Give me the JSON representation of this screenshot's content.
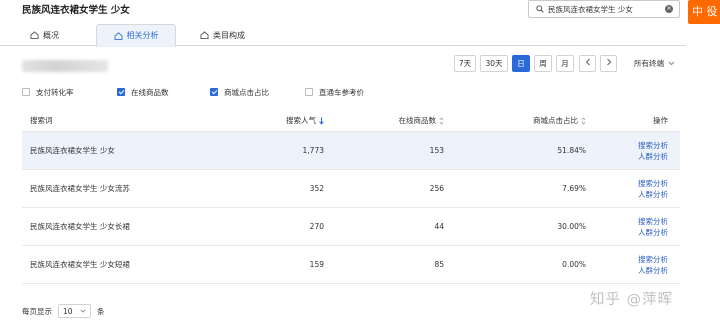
{
  "title": "民族风连衣裙女学生 少女",
  "search": {
    "value": "民族风连衣裙女学生 少女"
  },
  "side_tab": "中 役",
  "tabs": [
    {
      "label": "概况"
    },
    {
      "label": "相关分析"
    },
    {
      "label": "类目构成"
    }
  ],
  "date_buttons": [
    "7天",
    "30天",
    "日",
    "周",
    "月"
  ],
  "terminal": "所有终端",
  "checkboxes": [
    {
      "label": "支付转化率",
      "checked": false
    },
    {
      "label": "在线商品数",
      "checked": true
    },
    {
      "label": "商城点击占比",
      "checked": true
    },
    {
      "label": "直通车参考价",
      "checked": false
    }
  ],
  "table": {
    "headers": [
      "搜索词",
      "搜索人气",
      "在线商品数",
      "商城点击占比",
      "操作"
    ],
    "rows": [
      {
        "keyword": "民族风连衣裙女学生 少女",
        "popularity": "1,773",
        "count": "153",
        "ratio": "51.84%"
      },
      {
        "keyword": "民族风连衣裙女学生 少女流苏",
        "popularity": "352",
        "count": "256",
        "ratio": "7.69%"
      },
      {
        "keyword": "民族风连衣裙女学生 少女长裙",
        "popularity": "270",
        "count": "44",
        "ratio": "30.00%"
      },
      {
        "keyword": "民族风连衣裙女学生 少女短裙",
        "popularity": "159",
        "count": "85",
        "ratio": "0.00%"
      }
    ],
    "ops": [
      "搜索分析",
      "人群分析"
    ]
  },
  "pager": {
    "prefix": "每页显示",
    "size": "10",
    "suffix": "条"
  },
  "watermark": "知乎 @萍晖",
  "colors": {
    "accent": "#2a6ad8",
    "side_tab": "#ff6a00",
    "link": "#2a5fc4",
    "row_highlight": "#eef3fb"
  }
}
